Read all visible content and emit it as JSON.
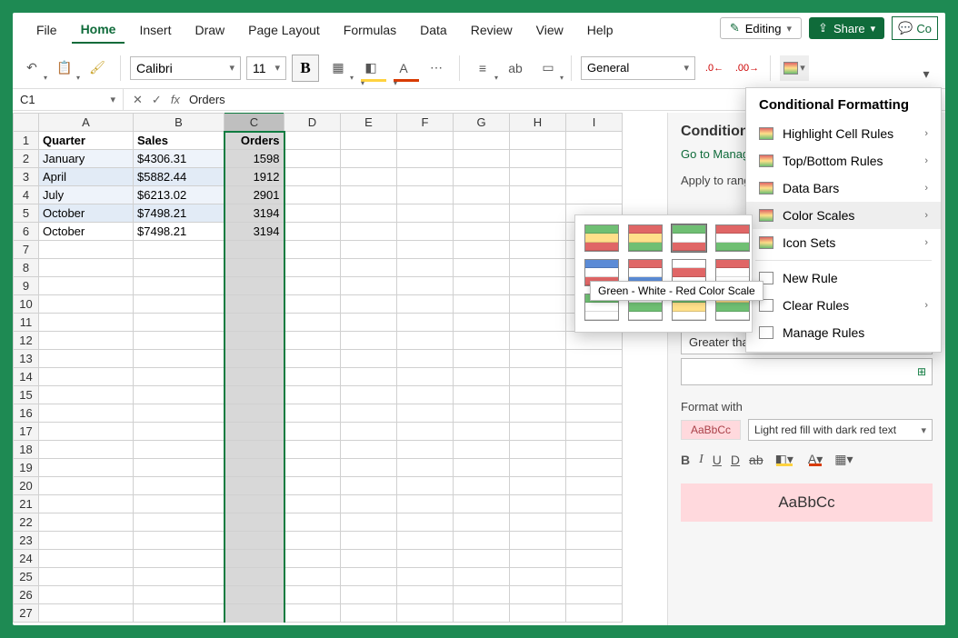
{
  "tabs": [
    "File",
    "Home",
    "Insert",
    "Draw",
    "Page Layout",
    "Formulas",
    "Data",
    "Review",
    "View",
    "Help"
  ],
  "active_tab": "Home",
  "buttons": {
    "editing": "Editing",
    "share": "Share",
    "comment": "Co"
  },
  "toolbar": {
    "font": "Calibri",
    "size": "11",
    "bold": "B",
    "number_format": "General",
    "dec_less": ".0",
    "dec_more": ".00"
  },
  "formula_bar": {
    "name": "C1",
    "value": "Orders"
  },
  "columns": [
    "A",
    "B",
    "C",
    "D",
    "E",
    "F",
    "G",
    "H",
    "I"
  ],
  "headers": {
    "a": "Quarter",
    "b": "Sales",
    "c": "Orders"
  },
  "rows": [
    {
      "a": "January",
      "b": "$4306.31",
      "c": "1598"
    },
    {
      "a": "April",
      "b": "$5882.44",
      "c": "1912"
    },
    {
      "a": "July",
      "b": "$6213.02",
      "c": "2901"
    },
    {
      "a": "October",
      "b": "$7498.21",
      "c": "3194"
    },
    {
      "a": "October",
      "b": "$7498.21",
      "c": "3194"
    }
  ],
  "row_count": 27,
  "pane": {
    "title": "Conditional Formatting",
    "link": "Go to Manage Rules",
    "apply": "Apply to range",
    "cond_label": "Greater than",
    "format_with": "Format with",
    "sample_small": "AaBbCc",
    "fmt_desc": "Light red fill with dark red text",
    "big_sample": "AaBbCc"
  },
  "cf_menu": {
    "title": "Conditional Formatting",
    "items": [
      "Highlight Cell Rules",
      "Top/Bottom Rules",
      "Data Bars",
      "Color Scales",
      "Icon Sets"
    ],
    "hover_index": 3,
    "footer": [
      "New Rule",
      "Clear Rules",
      "Manage Rules"
    ]
  },
  "color_scale": {
    "tooltip": "Green - White - Red Color Scale",
    "swatches": [
      [
        "#6fbf73",
        "#ffe08a",
        "#e06666"
      ],
      [
        "#e06666",
        "#ffe08a",
        "#6fbf73"
      ],
      [
        "#6fbf73",
        "#ffffff",
        "#e06666"
      ],
      [
        "#e06666",
        "#ffffff",
        "#6fbf73"
      ],
      [
        "#5b8bd6",
        "#ffffff",
        "#e06666"
      ],
      [
        "#e06666",
        "#ffffff",
        "#5b8bd6"
      ],
      [
        "#ffffff",
        "#e06666",
        "#ffffff"
      ],
      [
        "#e06666",
        "#ffffff",
        "#ffffff"
      ],
      [
        "#6fbf73",
        "#ffffff",
        "#ffffff"
      ],
      [
        "#ffffff",
        "#6fbf73",
        "#ffffff"
      ],
      [
        "#6fbf73",
        "#ffe08a",
        "#ffffff"
      ],
      [
        "#ffe08a",
        "#6fbf73",
        "#ffffff"
      ]
    ],
    "selected_index": 2
  }
}
